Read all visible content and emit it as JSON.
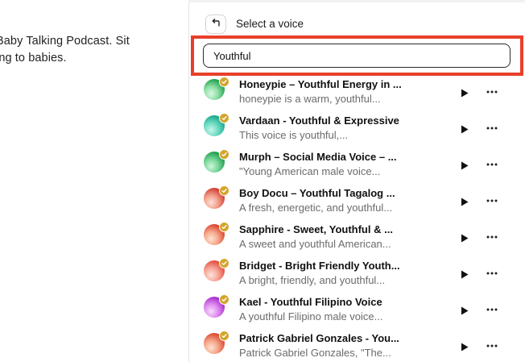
{
  "left_pane": {
    "line1": "Baby Talking Podcast. Sit",
    "line2": "ing to babies."
  },
  "header": {
    "back_icon": "return-arrow-icon",
    "title": "Select a voice"
  },
  "search": {
    "value": "Youthful",
    "highlight_color": "#e8402a"
  },
  "voices": [
    {
      "name": "Honeypie – Youthful Energy in ...",
      "desc": "honeypie is a warm, youthful...",
      "avatar_colors": [
        "#1d9e4b",
        "#8fe0a6",
        "#d9f7e3"
      ]
    },
    {
      "name": "Vardaan - Youthful & Expressive",
      "desc": "This voice is youthful,...",
      "avatar_colors": [
        "#17a58b",
        "#6fdcc3",
        "#c9f4ea"
      ]
    },
    {
      "name": "Murph – Social Media Voice – ...",
      "desc": "\"Young American male voice...",
      "avatar_colors": [
        "#1f9a4c",
        "#7ad99b",
        "#d2f5de"
      ]
    },
    {
      "name": "Boy Docu – Youthful Tagalog ...",
      "desc": "A fresh, energetic, and youthful...",
      "avatar_colors": [
        "#d2382f",
        "#f2a28e",
        "#fde1d6"
      ]
    },
    {
      "name": "Sapphire - Sweet, Youthful & ...",
      "desc": "A sweet and youthful American...",
      "avatar_colors": [
        "#d8402c",
        "#f6a98c",
        "#fde3d4"
      ]
    },
    {
      "name": "Bridget - Bright Friendly Youth...",
      "desc": "A bright, friendly, and youthful...",
      "avatar_colors": [
        "#e04a3c",
        "#f7a89a",
        "#fde3dd"
      ]
    },
    {
      "name": "Kael - Youthful Filipino Voice",
      "desc": "A youthful Filipino male voice...",
      "avatar_colors": [
        "#a42bc9",
        "#e08df2",
        "#f6dcfb"
      ]
    },
    {
      "name": "Patrick Gabriel Gonzales - You...",
      "desc": "Patrick Gabriel Gonzales, \"The...",
      "avatar_colors": [
        "#d8452e",
        "#f5a68a",
        "#fde2d2"
      ]
    }
  ],
  "badge_color": "#d4a52b",
  "row_icons": {
    "play": "play-icon",
    "more": "more-options-icon",
    "badge": "verified-badge-icon"
  }
}
